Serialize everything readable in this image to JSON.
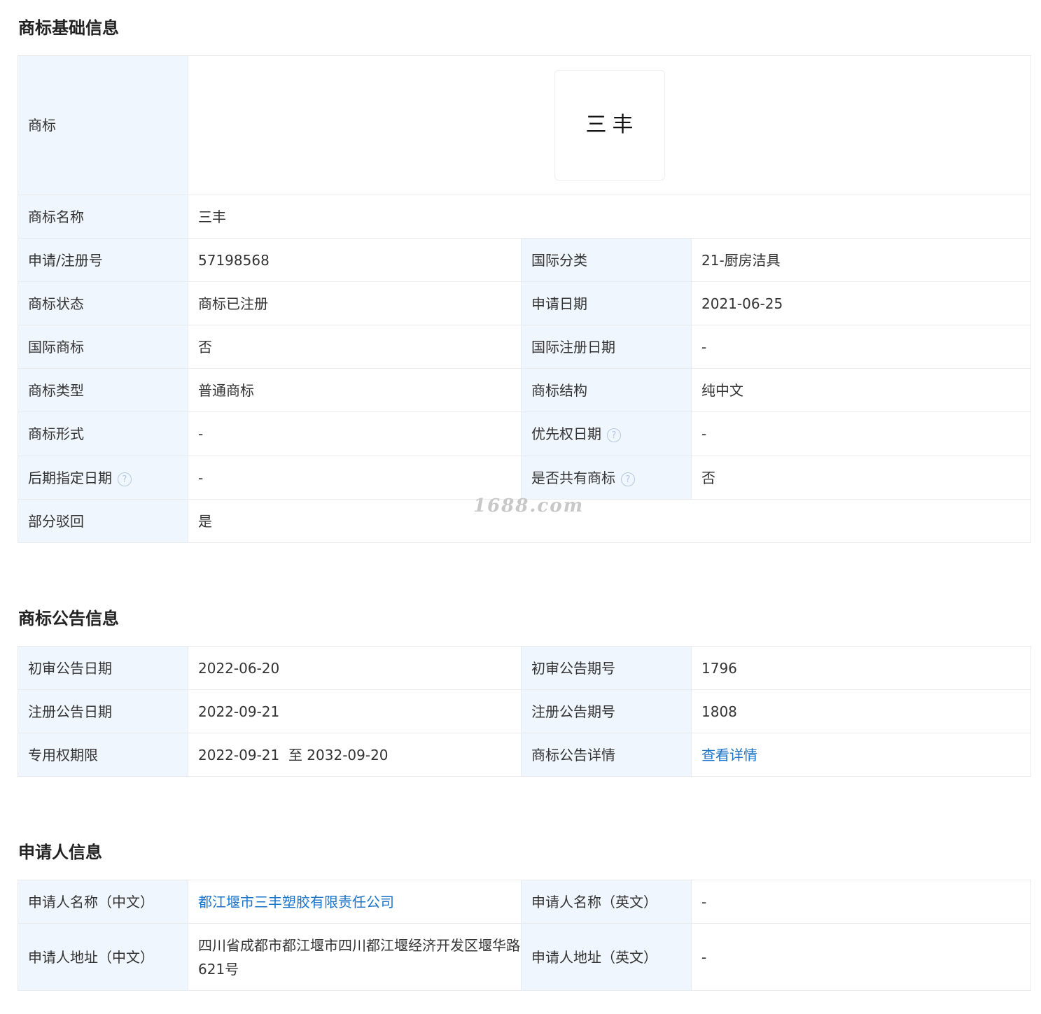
{
  "basic": {
    "title": "商标基础信息",
    "logo_label": "商标",
    "logo_text": "三丰",
    "name_label": "商标名称",
    "name_value": "三丰",
    "rows": [
      {
        "l1": "申请/注册号",
        "v1": "57198568",
        "l2": "国际分类",
        "v2": "21-厨房洁具"
      },
      {
        "l1": "商标状态",
        "v1": "商标已注册",
        "l2": "申请日期",
        "v2": "2021-06-25"
      },
      {
        "l1": "国际商标",
        "v1": "否",
        "l2": "国际注册日期",
        "v2": "-"
      },
      {
        "l1": "商标类型",
        "v1": "普通商标",
        "l2": "商标结构",
        "v2": "纯中文"
      },
      {
        "l1": "商标形式",
        "v1": "-",
        "l2": "优先权日期",
        "v2": "-"
      },
      {
        "l1": "后期指定日期",
        "v1": "-",
        "l2": "是否共有商标",
        "v2": "否"
      }
    ],
    "rejected_label": "部分驳回",
    "rejected_value": "是"
  },
  "help_glyph": "?",
  "watermark": "1688.com",
  "notice": {
    "title": "商标公告信息",
    "rows": [
      {
        "l1": "初审公告日期",
        "v1": "2022-06-20",
        "l2": "初审公告期号",
        "v2": "1796"
      },
      {
        "l1": "注册公告日期",
        "v1": "2022-09-21",
        "l2": "注册公告期号",
        "v2": "1808"
      },
      {
        "l1": "专用权期限",
        "v1": "2022-09-21  至 2032-09-20",
        "l2": "商标公告详情",
        "v2": "查看详情"
      }
    ]
  },
  "applicant": {
    "title": "申请人信息",
    "rows": [
      {
        "l1": "申请人名称（中文）",
        "v1": "都江堰市三丰塑胶有限责任公司",
        "l2": "申请人名称（英文）",
        "v2": "-"
      },
      {
        "l1": "申请人地址（中文）",
        "v1": "四川省成都市都江堰市四川都江堰经济开发区堰华路621号",
        "l2": "申请人地址（英文）",
        "v2": "-"
      }
    ]
  },
  "colors": {
    "label_bg": "#f0f6fd",
    "border": "#e8eaee",
    "link": "#1a73c9"
  }
}
